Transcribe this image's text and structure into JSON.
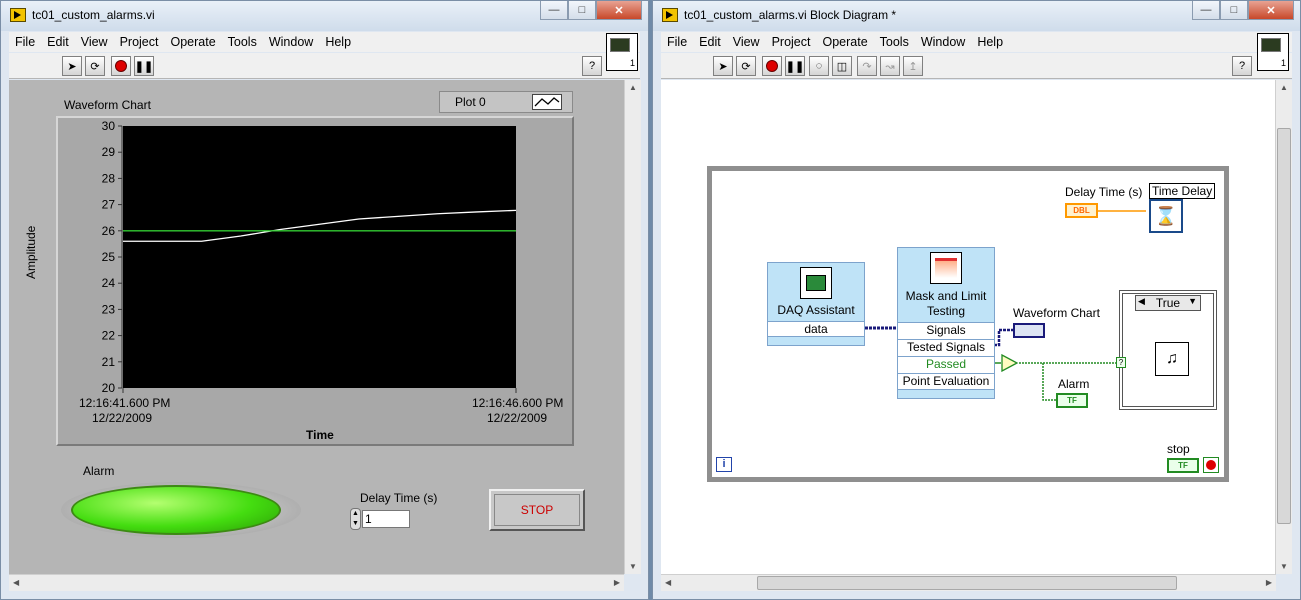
{
  "front_panel": {
    "title": "tc01_custom_alarms.vi",
    "menu": [
      "File",
      "Edit",
      "View",
      "Project",
      "Operate",
      "Tools",
      "Window",
      "Help"
    ],
    "icon_number": "1",
    "chart": {
      "label": "Waveform Chart",
      "legend_plot": "Plot 0",
      "y_axis_label": "Amplitude",
      "x_axis_label": "Time",
      "x_start_time": "12:16:41.600 PM",
      "x_start_date": "12/22/2009",
      "x_end_time": "12:16:46.600 PM",
      "x_end_date": "12/22/2009",
      "y_ticks": [
        "30",
        "29",
        "28",
        "27",
        "26",
        "25",
        "24",
        "23",
        "22",
        "21",
        "20"
      ]
    },
    "alarm_label": "Alarm",
    "delay_label": "Delay Time (s)",
    "delay_value": "1",
    "stop_label": "STOP"
  },
  "block_diagram": {
    "title": "tc01_custom_alarms.vi Block Diagram *",
    "menu": [
      "File",
      "Edit",
      "View",
      "Project",
      "Operate",
      "Tools",
      "Window",
      "Help"
    ],
    "icon_number": "1",
    "delay_time_label": "Delay Time (s)",
    "dbl_terminal": "DBL",
    "time_delay_label": "Time Delay",
    "daq_assistant_label": "DAQ Assistant",
    "daq_output": "data",
    "mask_label": "Mask and Limit Testing",
    "mask_ports": [
      "Signals",
      "Tested Signals",
      "Passed",
      "Point Evaluation"
    ],
    "waveform_chart_label": "Waveform Chart",
    "alarm_label": "Alarm",
    "case_selector": "True",
    "stop_label": "stop",
    "tf_terminal": "TF",
    "loop_iteration": "i"
  },
  "chart_data": {
    "type": "line",
    "title": "Waveform Chart",
    "xlabel": "Time",
    "ylabel": "Amplitude",
    "ylim": [
      20,
      30
    ],
    "x_range": [
      "12:16:41.600 PM",
      "12:16:46.600 PM"
    ],
    "series": [
      {
        "name": "Plot 0",
        "color": "#ffffff",
        "x": [
          0,
          0.4,
          1.0,
          1.5,
          2.0,
          2.5,
          3.0,
          3.5,
          4.0,
          4.5,
          5.0
        ],
        "values": [
          25.6,
          25.6,
          25.6,
          25.8,
          26.05,
          26.25,
          26.45,
          26.55,
          26.65,
          26.72,
          26.78
        ]
      },
      {
        "name": "",
        "color": "#33cc33",
        "x": [
          0,
          5.0
        ],
        "values": [
          26.0,
          26.0
        ]
      }
    ],
    "grid": false
  }
}
